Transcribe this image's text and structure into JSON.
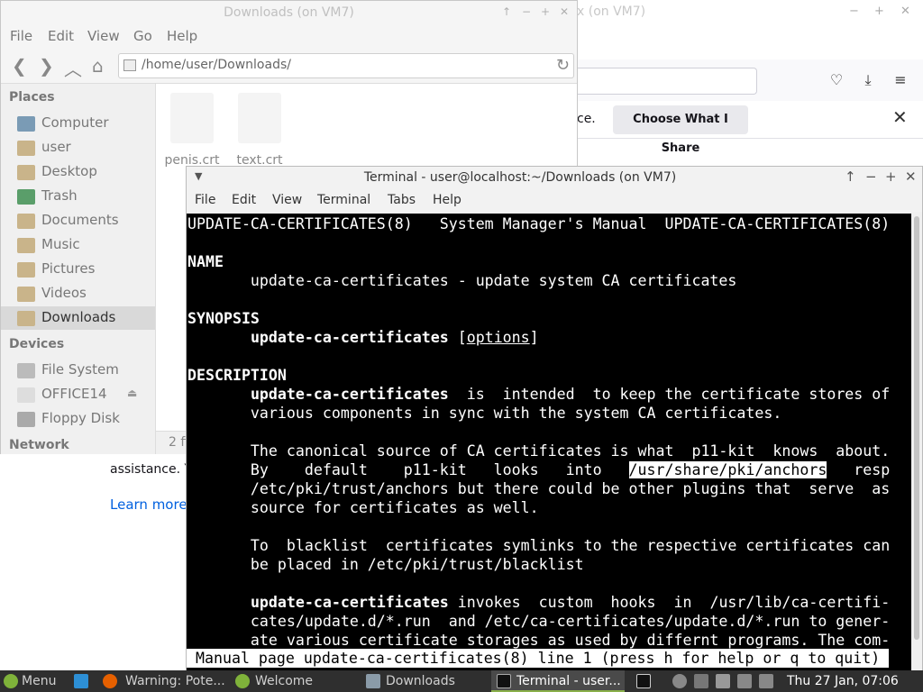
{
  "firefox": {
    "title": "x (on VM7)",
    "notification_text": "ce.",
    "choose_button": "Choose What I Share",
    "body_text": "assistance. Y",
    "learn_more": "Learn more"
  },
  "file_manager": {
    "title": "Downloads (on VM7)",
    "menu": [
      "File",
      "Edit",
      "View",
      "Go",
      "Help"
    ],
    "path": "/home/user/Downloads/",
    "places_header": "Places",
    "places": [
      {
        "label": "Computer",
        "color": "#7a9bb5"
      },
      {
        "label": "user",
        "color": "#c9b48a"
      },
      {
        "label": "Desktop",
        "color": "#c9b48a"
      },
      {
        "label": "Trash",
        "color": "#5a9e6a"
      },
      {
        "label": "Documents",
        "color": "#c9b48a"
      },
      {
        "label": "Music",
        "color": "#c9b48a"
      },
      {
        "label": "Pictures",
        "color": "#c9b48a"
      },
      {
        "label": "Videos",
        "color": "#c9b48a"
      },
      {
        "label": "Downloads",
        "color": "#c9b48a"
      }
    ],
    "devices_header": "Devices",
    "devices": [
      {
        "label": "File System",
        "color": "#bbbbbb"
      },
      {
        "label": "OFFICE14",
        "color": "#dddddd"
      },
      {
        "label": "Floppy Disk",
        "color": "#aaaaaa"
      }
    ],
    "network_header": "Network",
    "files": [
      "penis.crt",
      "text.crt"
    ],
    "status": "2 fi"
  },
  "terminal": {
    "title": "Terminal - user@localhost:~/Downloads (on VM7)",
    "menu": [
      "File",
      "Edit",
      "View",
      "Terminal",
      "Tabs",
      "Help"
    ],
    "lines": {
      "l1": "UPDATE-CA-CERTIFICATES(8)   System Manager's Manual  UPDATE-CA-CERTIFICATES(8)",
      "l3": "NAME",
      "l4": "       update-ca-certificates - update system CA certificates",
      "l6": "SYNOPSIS",
      "l7_cmd": "update-ca-certificates",
      "l7_opt": "options",
      "l9": "DESCRIPTION",
      "l10_cmd": "update-ca-certificates",
      "l10_rest": "  is  intended  to keep the certificate stores of",
      "l11": "       various components in sync with the system CA certificates.",
      "l13": "       The canonical source of CA certificates is what  p11-kit  knows  about.",
      "l14_pre": "       By    default    p11-kit   looks   into   ",
      "l14_sel": "/usr/share/pki/anchors",
      "l14_post": "   resp",
      "l15": "       /etc/pki/trust/anchors but there could be other plugins that  serve  as",
      "l16": "       source for certificates as well.",
      "l18": "       To  blacklist  certificates symlinks to the respective certificates can",
      "l19": "       be placed in /etc/pki/trust/blacklist",
      "l21_cmd": "update-ca-certificates",
      "l21_rest": " invokes  custom  hooks  in  /usr/lib/ca-certifi-",
      "l22": "       cates/update.d/*.run  and /etc/ca-certificates/update.d/*.run to gener-",
      "l23": "       ate various certificate storages as used by differnt programs. The com-"
    },
    "status_line": "Manual page update-ca-certificates(8) line 1 (press h for help or q to quit)"
  },
  "taskbar": {
    "menu": "Menu",
    "items": [
      "Warning: Pote...",
      "Welcome",
      "Downloads",
      "Terminal - user..."
    ],
    "clock": "Thu 27 Jan, 07:06"
  }
}
